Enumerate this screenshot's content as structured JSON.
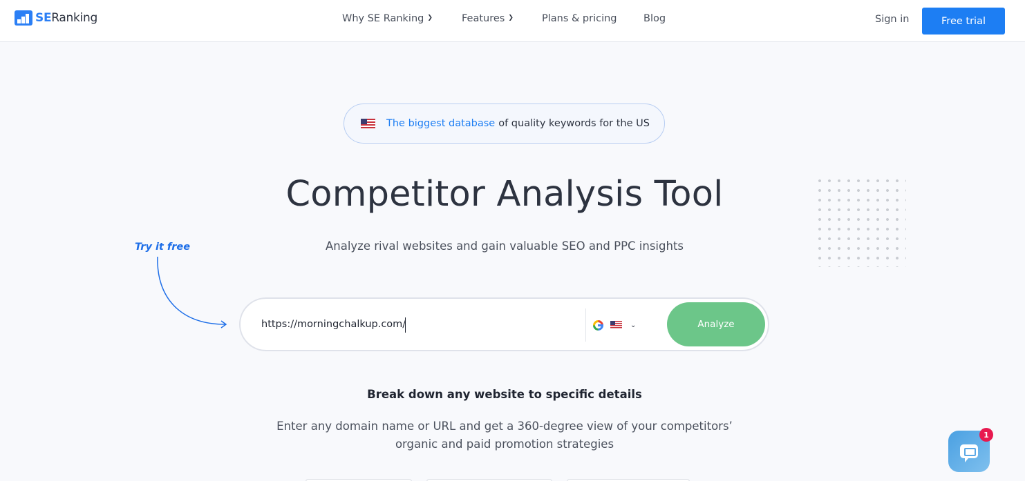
{
  "header": {
    "logo": {
      "brand_short": "SE",
      "brand_rest": "Ranking"
    },
    "nav": [
      {
        "label": "Why SE Ranking",
        "has_dropdown": true
      },
      {
        "label": "Features",
        "has_dropdown": true
      },
      {
        "label": "Plans & pricing",
        "has_dropdown": false
      },
      {
        "label": "Blog",
        "has_dropdown": false
      }
    ],
    "sign_in_label": "Sign in",
    "free_trial_label": "Free trial"
  },
  "hero": {
    "badge": {
      "flag_icon": "us-flag-icon",
      "highlight": "The biggest database",
      "rest": "of quality keywords for the US"
    },
    "title": "Competitor Analysis Tool",
    "subtitle": "Analyze rival websites and gain valuable SEO and PPC insights",
    "try_free_label": "Try it free",
    "search": {
      "value": "https://morningchalkup.com/",
      "placeholder": "",
      "engine_icon": "google-icon",
      "region_icon": "us-flag-icon",
      "analyze_label": "Analyze"
    }
  },
  "details": {
    "heading": "Break down any website to specific details",
    "description": "Enter any domain name or URL and get a 360-degree view of your competitors’ organic and paid promotion strategies"
  },
  "chat_widget": {
    "unread_count": "1"
  },
  "colors": {
    "brand_blue": "#1d7ef3",
    "analyze_green": "#6cc689",
    "notification_red": "#e8194f",
    "background": "#f8f9fc"
  }
}
